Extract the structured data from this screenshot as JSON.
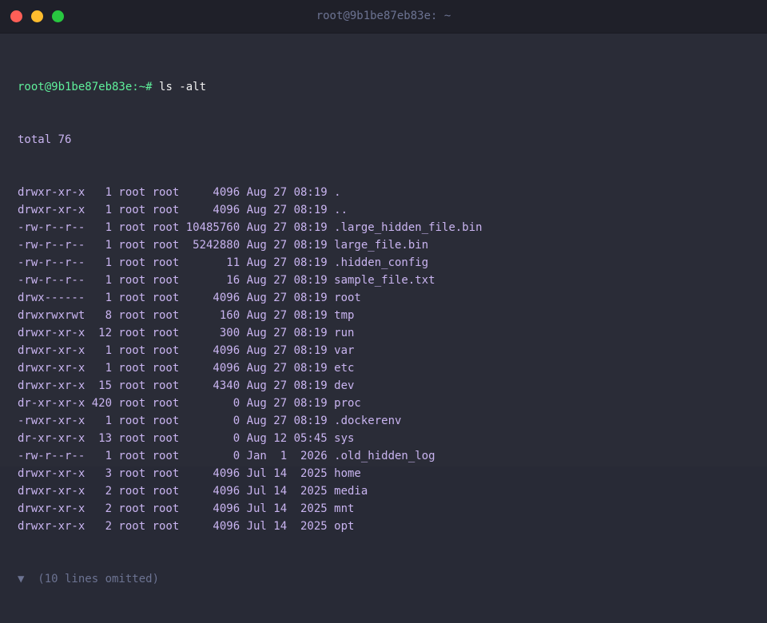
{
  "window": {
    "title": "root@9b1be87eb83e: ~",
    "buttons": [
      {
        "name": "close",
        "color": "#ff5f57"
      },
      {
        "name": "minimize",
        "color": "#febc2e"
      },
      {
        "name": "zoom",
        "color": "#28c840"
      }
    ]
  },
  "terminal": {
    "prompt": "root@9b1be87eb83e:~#",
    "command": "ls -alt",
    "total": "total 76",
    "entries": [
      "drwxr-xr-x   1 root root     4096 Aug 27 08:19 .",
      "drwxr-xr-x   1 root root     4096 Aug 27 08:19 ..",
      "-rw-r--r--   1 root root 10485760 Aug 27 08:19 .large_hidden_file.bin",
      "-rw-r--r--   1 root root  5242880 Aug 27 08:19 large_file.bin",
      "-rw-r--r--   1 root root       11 Aug 27 08:19 .hidden_config",
      "-rw-r--r--   1 root root       16 Aug 27 08:19 sample_file.txt",
      "drwx------   1 root root     4096 Aug 27 08:19 root",
      "drwxrwxrwt   8 root root      160 Aug 27 08:19 tmp",
      "drwxr-xr-x  12 root root      300 Aug 27 08:19 run",
      "drwxr-xr-x   1 root root     4096 Aug 27 08:19 var",
      "drwxr-xr-x   1 root root     4096 Aug 27 08:19 etc",
      "drwxr-xr-x  15 root root     4340 Aug 27 08:19 dev",
      "dr-xr-xr-x 420 root root        0 Aug 27 08:19 proc",
      "-rwxr-xr-x   1 root root        0 Aug 27 08:19 .dockerenv",
      "dr-xr-xr-x  13 root root        0 Aug 12 05:45 sys",
      "-rw-r--r--   1 root root        0 Jan  1  2026 .old_hidden_log",
      "drwxr-xr-x   3 root root     4096 Jul 14  2025 home",
      "drwxr-xr-x   2 root root     4096 Jul 14  2025 media",
      "drwxr-xr-x   2 root root     4096 Jul 14  2025 mnt",
      "drwxr-xr-x   2 root root     4096 Jul 14  2025 opt"
    ],
    "omitted": "▼  (10 lines omitted)"
  },
  "colors": {
    "prompt": "#5ff09b",
    "output": "#c9b4f0",
    "command": "#f2f2f2",
    "muted": "#6c7392",
    "background": "#2a2c37"
  }
}
